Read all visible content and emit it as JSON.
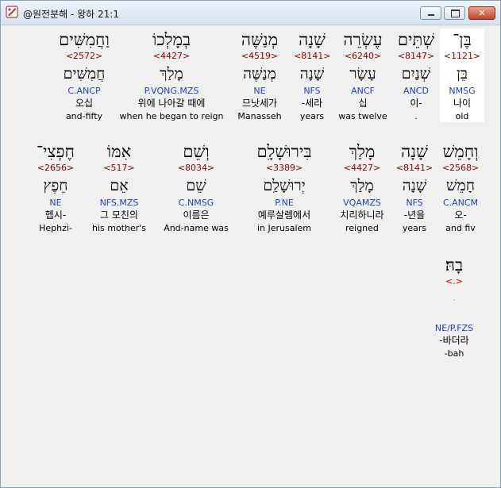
{
  "window": {
    "title": "@원전분해 - 왕하 21:1",
    "controls": {
      "minimize": "",
      "maximize": "",
      "close": "✕"
    }
  },
  "rows": [
    {
      "words": [
        {
          "heb": "בֶּן־",
          "strong": "<1121>",
          "lex": "בֵּן",
          "parse": "NMSG",
          "kor": "나이",
          "eng": "old",
          "selected": true
        },
        {
          "heb": "שְׁתֵּים",
          "strong": "<8147>",
          "lex": "שְׁנַיִם",
          "parse": "ANCD",
          "kor": "이-",
          "eng": "."
        },
        {
          "heb": "עֶשְׂרֵה",
          "strong": "<6240>",
          "lex": "עָשָׂר",
          "parse": "ANCF",
          "kor": "십",
          "eng": "was twelve"
        },
        {
          "heb": "שָׁנָה",
          "strong": "<8141>",
          "lex": "שָׁנָה",
          "parse": "NFS",
          "kor": "-세라",
          "eng": "years"
        },
        {
          "heb": "מְנַשֶּׁה",
          "strong": "<4519>",
          "lex": "מְנַשֶּׁה",
          "parse": "NE",
          "kor": "므낫세가",
          "eng": "Manasseh"
        },
        {
          "heb": "בְמָלְכוֹ",
          "strong": "<4427>",
          "lex": "מָלַךְ",
          "parse": "P.VQNG.MZS",
          "kor": "위에 나아갈 때에",
          "eng": "when he began to reign"
        },
        {
          "heb": "וַחֲמִשִּׁים",
          "strong": "<2572>",
          "lex": "חֲמִשִּׁים",
          "parse": "C.ANCP",
          "kor": "오십",
          "eng": "and-fifty"
        }
      ]
    },
    {
      "words": [
        {
          "heb": "וְחָמֵשׁ",
          "strong": "<2568>",
          "lex": "חָמֵשׁ",
          "parse": "C.ANCM",
          "kor": "오-",
          "eng": "and fiv"
        },
        {
          "heb": "שָׁנָה",
          "strong": "<8141>",
          "lex": "שָׁנָה",
          "parse": "NFS",
          "kor": "-년을",
          "eng": "years"
        },
        {
          "heb": "מָלַךְ",
          "strong": "<4427>",
          "lex": "מָלַךְ",
          "parse": "VQAMZS",
          "kor": "치리하니라",
          "eng": "reigned"
        },
        {
          "heb": "בִּירוּשָׁלִָם",
          "strong": "<3389>",
          "lex": "יְרוּשָׁלִַם",
          "parse": "P.NE",
          "kor": "예루살렘에서",
          "eng": "in Jerusalem"
        },
        {
          "heb": "וְשֵׁם",
          "strong": "<8034>",
          "lex": "שֵׁם",
          "parse": "C.NMSG",
          "kor": "이름은",
          "eng": "And-name was"
        },
        {
          "heb": "אִמּוֹ",
          "strong": "<517>",
          "lex": "אֵם",
          "parse": "NFS.MZS",
          "kor": "그 모친의",
          "eng": "his mother's"
        },
        {
          "heb": "חֶפְצִי־",
          "strong": "<2656>",
          "lex": "חֵפֶץ",
          "parse": "NE",
          "kor": "헵시-",
          "eng": "Hephzi-"
        }
      ]
    },
    {
      "words": [
        {
          "heb": "בָהּ׃",
          "strong": "<.>",
          "lex": "",
          "mark": "ׄ",
          "parse": "NE/P.FZS",
          "kor": "-바더라",
          "eng": "-bah"
        }
      ]
    }
  ]
}
